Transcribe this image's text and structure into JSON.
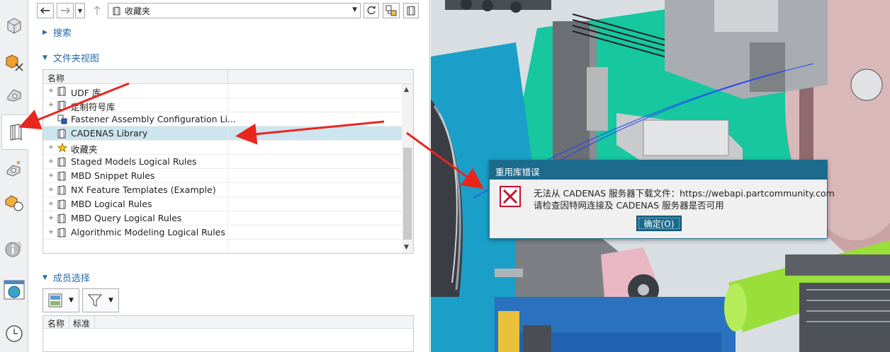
{
  "toolbar": {
    "back_icon": "arrow-left-icon",
    "forward_icon": "arrow-right-icon",
    "up_icon": "arrow-up-icon",
    "address_title": "收藏夹",
    "refresh_icon": "refresh-icon",
    "library_icon": "library-icon"
  },
  "sections": {
    "search": "搜索",
    "folder_view": "文件夹视图",
    "member_select": "成员选择"
  },
  "tree": {
    "column_header": "名称",
    "rows": [
      {
        "label": "UDF 库",
        "icon": "book",
        "expander": "+"
      },
      {
        "label": "定制符号库",
        "icon": "book",
        "expander": "+"
      },
      {
        "label": "Fastener Assembly Configuration Li...",
        "icon": "assembly",
        "expander": ""
      },
      {
        "label": "CADENAS Library",
        "icon": "book",
        "expander": "",
        "selected": true
      },
      {
        "label": "收藏夹",
        "icon": "star",
        "expander": "+"
      },
      {
        "label": "Staged Models Logical Rules",
        "icon": "book",
        "expander": "+"
      },
      {
        "label": "MBD Snippet Rules",
        "icon": "book",
        "expander": "+"
      },
      {
        "label": "NX Feature Templates (Example)",
        "icon": "book",
        "expander": "+"
      },
      {
        "label": "MBD Logical Rules",
        "icon": "book",
        "expander": "+"
      },
      {
        "label": "MBD Query Logical Rules",
        "icon": "book",
        "expander": "+"
      },
      {
        "label": "Algorithmic Modeling Logical Rules",
        "icon": "book",
        "expander": "+"
      }
    ]
  },
  "member": {
    "columns": [
      "名称",
      "标准"
    ]
  },
  "dialog": {
    "title": "重用库错误",
    "line1": "无法从 CADENAS 服务器下载文件：https://webapi.partcommunity.com",
    "line2": "请检查因特网连接及 CADENAS 服务器是否可用",
    "ok_label": "确定(O)"
  },
  "colors": {
    "accent": "#2a6aa8",
    "dialog_title_bg": "#1c6b8c",
    "selection": "#cde5ef",
    "arrow": "#e8261f"
  }
}
